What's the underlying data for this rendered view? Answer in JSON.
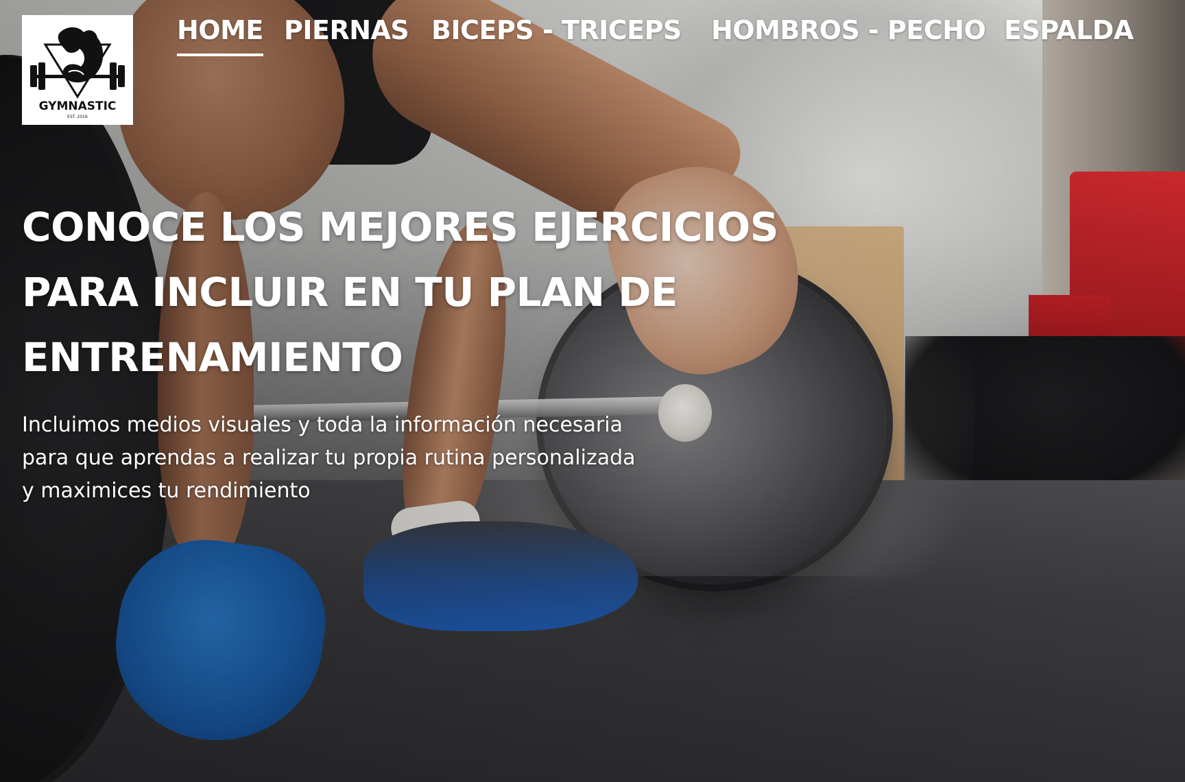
{
  "brand": {
    "logo_text": "GYMNASTIC",
    "logo_subtext": "EST. 2016"
  },
  "nav": {
    "items": [
      {
        "label": "HOME",
        "active": true
      },
      {
        "label": "PIERNAS",
        "active": false
      },
      {
        "label": "BICEPS - TRICEPS",
        "active": false
      },
      {
        "label": "HOMBROS - PECHO",
        "active": false
      },
      {
        "label": "ESPALDA",
        "active": false
      }
    ]
  },
  "hero": {
    "title_lines": [
      "CONOCE LOS MEJORES EJERCICIOS",
      "PARA INCLUIR EN TU PLAN DE",
      "ENTRENAMIENTO"
    ],
    "subtitle_lines": [
      "Incluimos medios visuales y toda la información necesaria",
      "para que aprendas a realizar tu propia rutina personalizada",
      "y maximices tu rendimiento"
    ],
    "background_image": "weightlifter-chalk-hands-barbell-photo"
  },
  "colors": {
    "text": "#ffffff",
    "logo_bg": "#ffffff",
    "logo_ink": "#111111"
  }
}
